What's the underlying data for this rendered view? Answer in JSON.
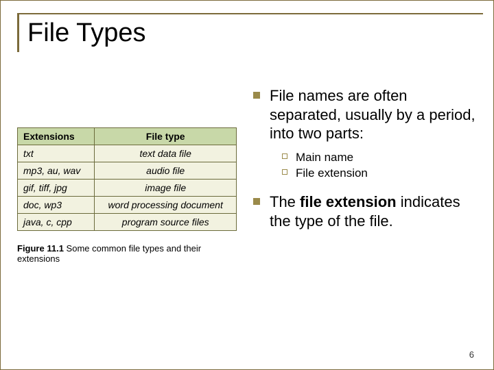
{
  "title": "File Types",
  "table": {
    "headers": {
      "ext": "Extensions",
      "ft": "File type"
    },
    "rows": [
      {
        "ext": "txt",
        "ft": "text data file"
      },
      {
        "ext": "mp3, au, wav",
        "ft": "audio file"
      },
      {
        "ext": "gif, tiff, jpg",
        "ft": "image file"
      },
      {
        "ext": "doc, wp3",
        "ft": "word processing document"
      },
      {
        "ext": "java, c, cpp",
        "ft": "program source files"
      }
    ]
  },
  "caption": {
    "fignum": "Figure 11.1",
    "text": "Some common file types and their extensions"
  },
  "bullets": {
    "b1": "File names are often separated, usually by a period, into two parts:",
    "sub1": "Main name",
    "sub2": "File extension",
    "b2_pre": "The ",
    "b2_bold": "file extension",
    "b2_post": " indicates the type of the file."
  },
  "page_number": "6"
}
